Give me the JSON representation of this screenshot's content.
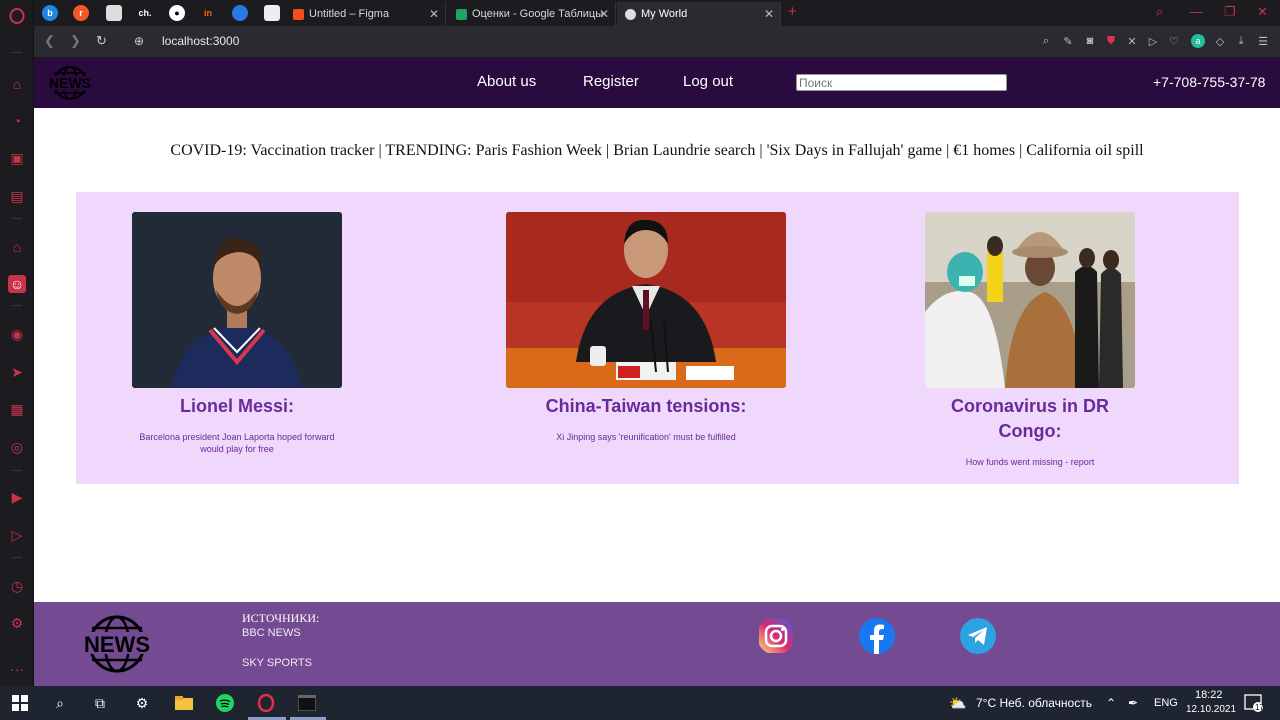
{
  "browser": {
    "pinned": [
      "b",
      "r",
      "ch.",
      "in"
    ],
    "tabs": [
      {
        "title": "Untitled – Figma"
      },
      {
        "title": "Оценки - Google Таблицы"
      },
      {
        "title": "My World"
      }
    ],
    "new_tab": "+",
    "url": "localhost:3000"
  },
  "site": {
    "logo_text": "NEWS",
    "nav": [
      "About us",
      "Register",
      "Log out"
    ],
    "search_placeholder": "Поиск",
    "phone": "+7-708-755-37-78",
    "trending": "COVID-19: Vaccination tracker | TRENDING: Paris Fashion Week | Brian Laundrie search | 'Six Days in Fallujah' game | €1 homes | California oil spill",
    "cards": [
      {
        "title": "Lionel Messi:",
        "desc": "Barcelona president Joan Laporta hoped forward would play for free"
      },
      {
        "title": "China-Taiwan tensions:",
        "desc": "Xi Jinping says 'reunification' must be fulfilled"
      },
      {
        "title": "Coronavirus in DR Congo:",
        "desc": "How funds went missing - report"
      }
    ],
    "footer": {
      "sources_heading": "ИСТОЧНИКИ:",
      "sources": [
        "BBC NEWS",
        "SKY SPORTS"
      ]
    }
  },
  "taskbar": {
    "weather": "7°C  Неб. облачность",
    "lang": "ENG",
    "time": "18:22",
    "date": "12.10.2021",
    "notifications": "17"
  },
  "colors": {
    "header": "#2a0b3f",
    "cards_bg": "#efd8fb",
    "card_text": "#6a2a9a",
    "footer": "#744a93",
    "opera_red": "#c8334a"
  }
}
